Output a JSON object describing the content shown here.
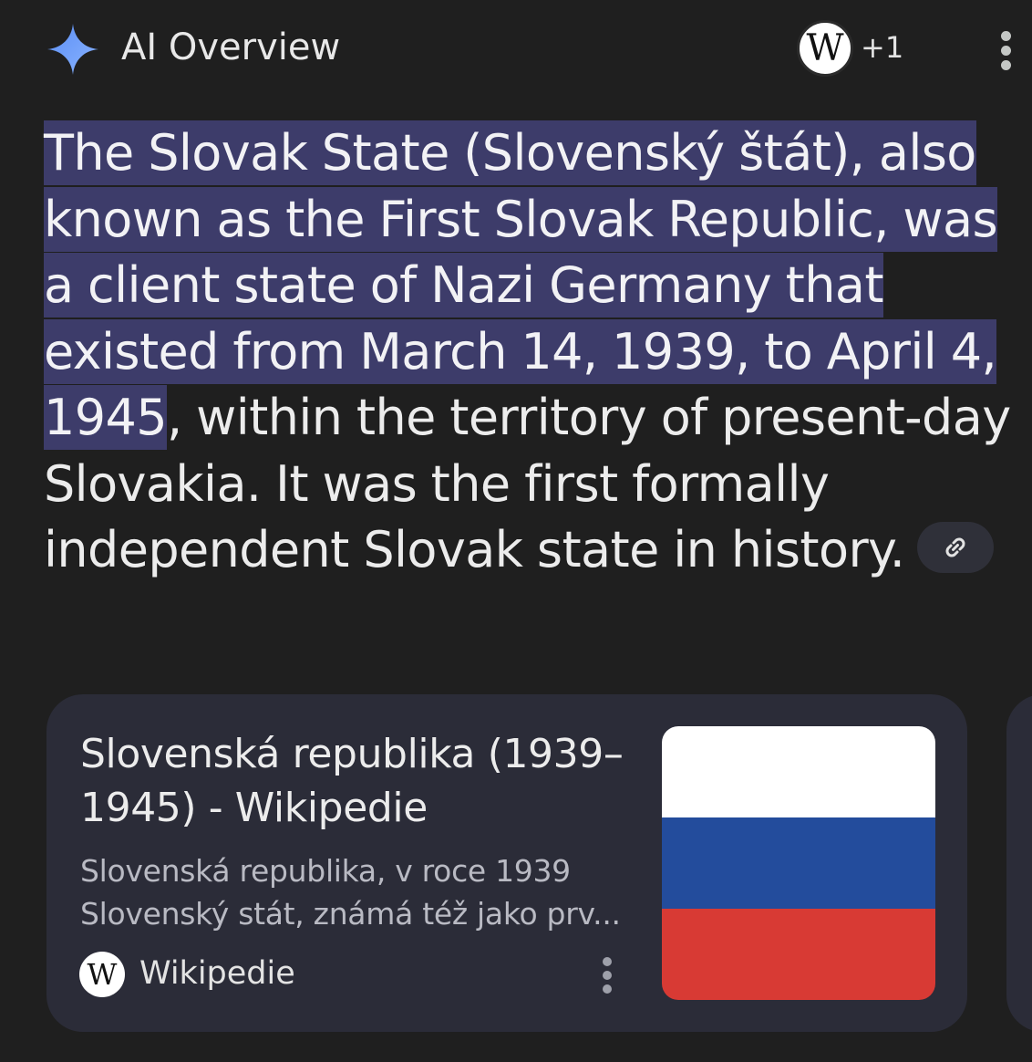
{
  "header": {
    "title": "AI Overview",
    "sparkle_icon": "sparkle-icon",
    "source_badge_letter": "W",
    "source_count": "+1",
    "more_icon": "more-vert-icon"
  },
  "overview": {
    "highlighted": " The Slovak State (Slovenský štát), also known as the First Slovak Republic, was a client state of Nazi Germany that existed from March 14, 1939, to April 4, 1945",
    "rest": ", within the territory of present-day Slovakia. It was the first formally independent Slovak state in history.",
    "link_icon": "link-icon"
  },
  "source_card": {
    "title": "Slovenská republika (1939–1945) - Wikipedie",
    "snippet": "Slovenská republika, v roce 1939 Slovenský stát, známá též jako prv...",
    "source_icon_letter": "W",
    "source_name": "Wikipedie",
    "more_icon": "more-vert-icon",
    "thumbnail": {
      "description": "flag",
      "colors": [
        "#ffffff",
        "#234c9c",
        "#d83a34"
      ]
    }
  },
  "colors": {
    "background": "#1f1f1f",
    "highlight": "#3d3c6a",
    "card": "#2b2c38",
    "sparkle_blue": "#6a9cf7"
  }
}
